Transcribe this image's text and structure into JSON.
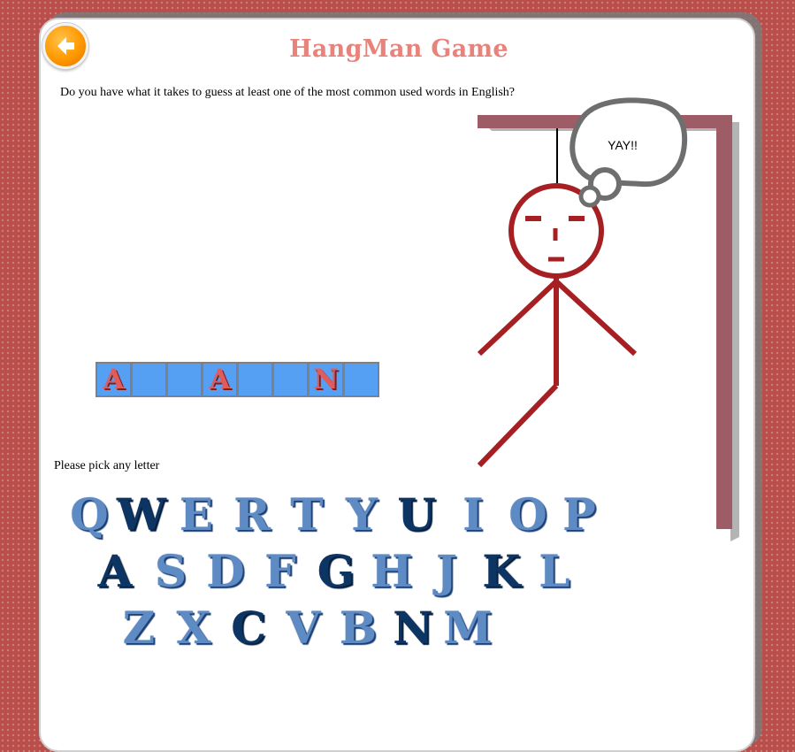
{
  "header": {
    "title": "HangMan Game"
  },
  "intro": "Do you have what it takes to guess at least one of the most common used words in English?",
  "speech": "YAY!!",
  "word": [
    "A",
    "",
    "",
    "A",
    "",
    "",
    "N",
    ""
  ],
  "prompt": "Please pick any letter",
  "keyboard": {
    "rows": [
      [
        "Q",
        "W",
        "E",
        "R",
        "T",
        "Y",
        "U",
        "I",
        "O",
        "P"
      ],
      [
        "A",
        "S",
        "D",
        "F",
        "G",
        "H",
        "J",
        "K",
        "L"
      ],
      [
        "Z",
        "X",
        "C",
        "V",
        "B",
        "N",
        "M"
      ]
    ],
    "used": [
      "W",
      "U",
      "A",
      "G",
      "K",
      "C",
      "N"
    ]
  },
  "colors": {
    "title": "#e8837b",
    "slot_fill": "#55a0f2",
    "revealed_letter": "#e25b5b",
    "gallows": "#9e5d66",
    "figure": "#a51f23",
    "key": "#5e8bc4",
    "key_used": "#0d3564"
  },
  "icons": {
    "back": "arrow-left-icon"
  }
}
